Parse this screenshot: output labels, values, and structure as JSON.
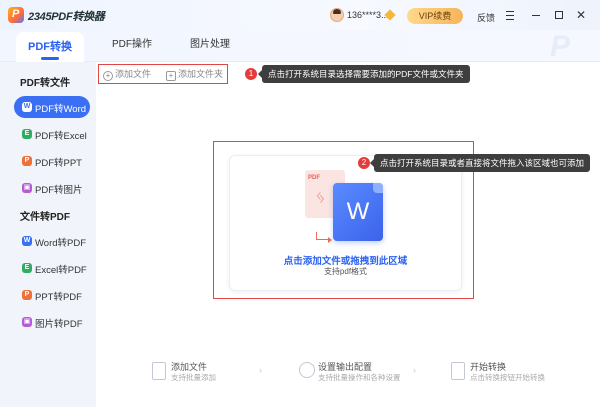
{
  "titlebar": {
    "logo_letter": "P",
    "app_title": "2345PDF转换器",
    "username": "136****3...",
    "vip_label": "VIP续费",
    "feedback_label": "反馈"
  },
  "tabs": [
    {
      "label": "PDF转换",
      "active": true
    },
    {
      "label": "PDF操作",
      "active": false
    },
    {
      "label": "图片处理",
      "active": false
    }
  ],
  "sidebar": {
    "section1": "PDF转文件",
    "section2": "文件转PDF",
    "items": [
      {
        "label": "PDF转Word",
        "icon": "word-icon",
        "active": true
      },
      {
        "label": "PDF转Excel",
        "icon": "excel-icon"
      },
      {
        "label": "PDF转PPT",
        "icon": "ppt-icon"
      },
      {
        "label": "PDF转图片",
        "icon": "image-icon"
      },
      {
        "label": "Word转PDF",
        "icon": "word-icon"
      },
      {
        "label": "Excel转PDF",
        "icon": "excel-icon"
      },
      {
        "label": "PPT转PDF",
        "icon": "ppt-icon"
      },
      {
        "label": "图片转PDF",
        "icon": "image-icon"
      }
    ]
  },
  "toolbar": {
    "add_file": "添加文件",
    "add_folder": "添加文件夹"
  },
  "tips": {
    "badge1": "1",
    "tip1": "点击打开系统目录选择需要添加的PDF文件或文件夹",
    "badge2": "2",
    "tip2": "点击打开系统目录或者直接将文件拖入该区域也可添加"
  },
  "drop_area": {
    "pdf_label": "PDF",
    "word_letter": "W",
    "title": "点击添加文件或拖拽到此区域",
    "subtitle": "支持pdf格式"
  },
  "steps": [
    {
      "title": "添加文件",
      "desc": "支持批量添加"
    },
    {
      "title": "设置输出配置",
      "desc": "支持批量操作和各种设置"
    },
    {
      "title": "开始转换",
      "desc": "点击转换按钮开始转换"
    }
  ],
  "colors": {
    "accent": "#2b62f0",
    "highlight_red": "#e14545",
    "vip_gold": "#f6b45a"
  }
}
